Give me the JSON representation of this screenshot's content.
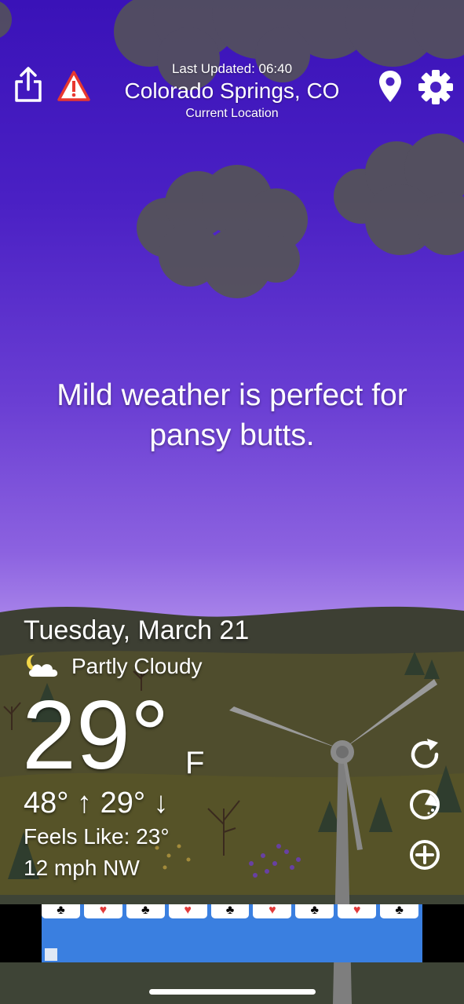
{
  "header": {
    "last_updated": "Last Updated: 06:40",
    "city": "Colorado Springs, CO",
    "location_label": "Current Location"
  },
  "quip": "Mild weather is perfect for pansy butts.",
  "weather": {
    "date": "Tuesday, March 21",
    "condition": "Partly Cloudy",
    "condition_icon": "partly-cloudy-night-icon",
    "temperature": "29°",
    "unit": "F",
    "high_low": "48° ↑  29° ↓",
    "feels_like": "Feels Like: 23°",
    "wind": "12 mph NW"
  },
  "icons": {
    "share": "share-icon",
    "alert": "warning-icon",
    "location": "location-pin-icon",
    "settings": "gear-icon",
    "refresh": "refresh-icon",
    "radar": "radar-icon",
    "add": "add-icon"
  },
  "ad": {
    "cards": [
      "♣",
      "♥",
      "♣",
      "♥",
      "♣",
      "♥",
      "♣",
      "♥",
      "♣"
    ]
  },
  "colors": {
    "sky_top": "#3a12b8",
    "sky_bottom": "#b89bef",
    "text": "#ffffff",
    "alert_red": "#e8372f",
    "ad_blue": "#3a7fe0"
  }
}
